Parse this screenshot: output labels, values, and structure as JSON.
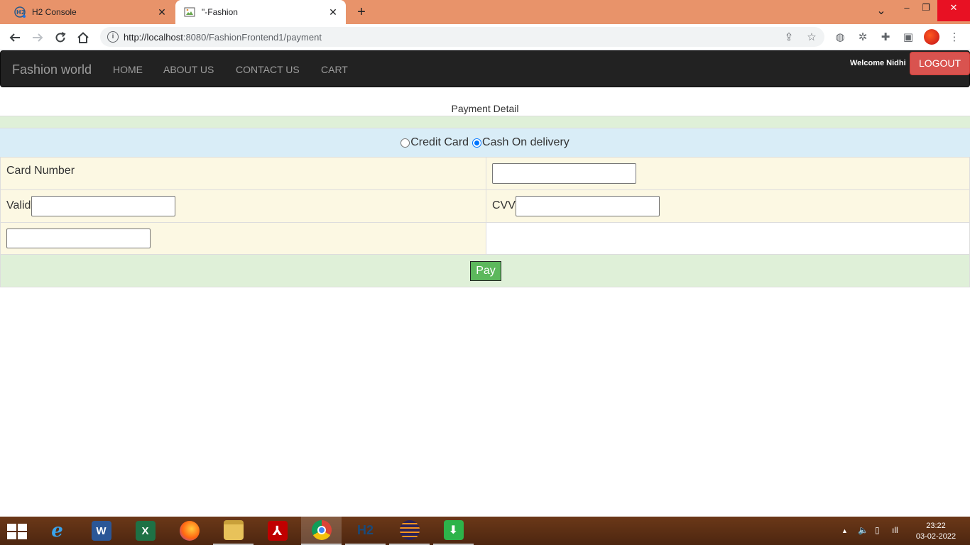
{
  "browser": {
    "tabs": [
      {
        "title": "H2 Console",
        "active": false
      },
      {
        "title": "\"-Fashion",
        "active": true
      }
    ],
    "new_tab_label": "+",
    "url_host": "http://localhost",
    "url_path": ":8080/FashionFrontend1/payment",
    "window_controls": {
      "minimize": "–",
      "restore": "❐",
      "close": "✕"
    }
  },
  "navbar": {
    "brand": "Fashion world",
    "links": [
      "HOME",
      "ABOUT US",
      "CONTACT US",
      "CART"
    ],
    "welcome": "Welcome Nidhi",
    "logout": "LOGOUT",
    "colors": {
      "bar": "#222222",
      "logout": "#d9534f"
    }
  },
  "payment": {
    "title": "Payment Detail",
    "options": [
      {
        "label": "Credit Card",
        "checked": false
      },
      {
        "label": "Cash On delivery",
        "checked": true
      }
    ],
    "card_number_label": "Card Number",
    "valid_label": "Valid",
    "cvv_label": "CVV",
    "card_number_value": "",
    "valid_value": "",
    "cvv_value": "",
    "extra_value": "",
    "pay_button": "Pay",
    "colors": {
      "success_row": "#dff0d8",
      "info_row": "#d9edf7",
      "warning_row": "#fcf8e3",
      "pay_button": "#5cb85c"
    }
  },
  "taskbar": {
    "apps": [
      "windows-start-icon",
      "internet-explorer-icon",
      "word-icon",
      "excel-icon",
      "firefox-icon",
      "file-explorer-icon",
      "acrobat-icon",
      "chrome-icon",
      "h2-icon",
      "eclipse-icon",
      "download-app-icon"
    ],
    "time": "23:22",
    "date": "03-02-2022"
  }
}
